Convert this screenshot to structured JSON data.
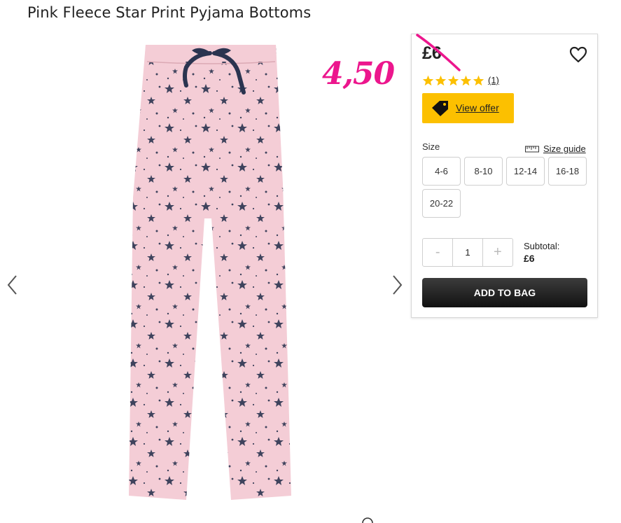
{
  "product": {
    "title": "Pink Fleece Star Print Pyjama Bottoms",
    "image_icon": "pink-star-print-pyjama-bottoms-image"
  },
  "annotation": {
    "handwritten_price": "4,50",
    "color": "#ec168d"
  },
  "panel": {
    "price": "£6",
    "rating": 5,
    "rating_max": 5,
    "review_count": "(1)",
    "star_color": "#fcc000",
    "offer": {
      "label": "View offer",
      "icon": "price-tag-icon",
      "color": "#fcc000"
    },
    "size": {
      "label": "Size",
      "guide_label": "Size guide",
      "guide_icon": "ruler-icon",
      "options": [
        "4-6",
        "8-10",
        "12-14",
        "16-18",
        "20-22"
      ]
    },
    "quantity": {
      "minus": "-",
      "value": "1",
      "plus": "+"
    },
    "subtotal": {
      "label": "Subtotal:",
      "value": "£6"
    },
    "add_to_bag": "ADD TO BAG"
  },
  "carousel": {
    "prev_icon": "chevron-left-icon",
    "next_icon": "chevron-right-icon"
  }
}
